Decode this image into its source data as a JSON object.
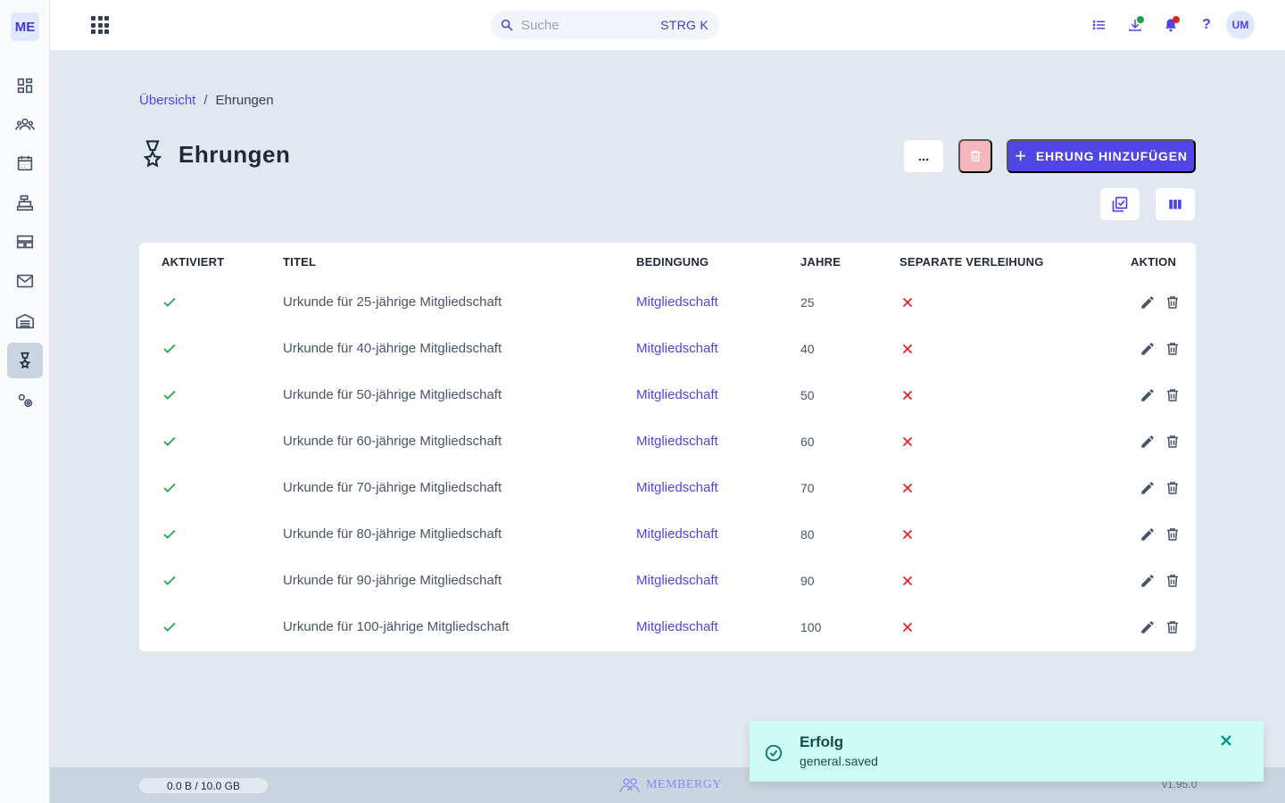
{
  "sidebar": {
    "logo": "ME",
    "items": [
      {
        "icon": "dashboard-icon"
      },
      {
        "icon": "members-icon"
      },
      {
        "icon": "calendar-icon"
      },
      {
        "icon": "cash-register-icon"
      },
      {
        "icon": "layout-icon"
      },
      {
        "icon": "mail-icon"
      },
      {
        "icon": "warehouse-icon"
      },
      {
        "icon": "medal-icon",
        "active": true
      },
      {
        "icon": "settings-icon"
      }
    ]
  },
  "topbar": {
    "search": {
      "placeholder": "Suche",
      "shortcut": "STRG K"
    },
    "avatar": "UM",
    "icons": [
      "task-list-icon",
      "download-icon",
      "bell-icon",
      "help-icon"
    ]
  },
  "breadcrumb": {
    "parent": "Übersicht",
    "separator": "/",
    "current": "Ehrungen"
  },
  "page": {
    "title": "Ehrungen",
    "more_label": "...",
    "add_label": "EHRUNG HINZUFÜGEN"
  },
  "table": {
    "headers": {
      "activated": "AKTIVIERT",
      "title": "TITEL",
      "condition": "BEDINGUNG",
      "years": "JAHRE",
      "separate": "SEPARATE VERLEIHUNG",
      "action": "AKTION"
    },
    "rows": [
      {
        "activated": true,
        "title": "Urkunde für 25-jährige Mitgliedschaft",
        "condition": "Mitgliedschaft",
        "years": "25",
        "separate": false
      },
      {
        "activated": true,
        "title": "Urkunde für 40-jährige Mitgliedschaft",
        "condition": "Mitgliedschaft",
        "years": "40",
        "separate": false
      },
      {
        "activated": true,
        "title": "Urkunde für 50-jährige Mitgliedschaft",
        "condition": "Mitgliedschaft",
        "years": "50",
        "separate": false
      },
      {
        "activated": true,
        "title": "Urkunde für 60-jährige Mitgliedschaft",
        "condition": "Mitgliedschaft",
        "years": "60",
        "separate": false
      },
      {
        "activated": true,
        "title": "Urkunde für 70-jährige Mitgliedschaft",
        "condition": "Mitgliedschaft",
        "years": "70",
        "separate": false
      },
      {
        "activated": true,
        "title": "Urkunde für 80-jährige Mitgliedschaft",
        "condition": "Mitgliedschaft",
        "years": "80",
        "separate": false
      },
      {
        "activated": true,
        "title": "Urkunde für 90-jährige Mitgliedschaft",
        "condition": "Mitgliedschaft",
        "years": "90",
        "separate": false
      },
      {
        "activated": true,
        "title": "Urkunde für 100-jährige Mitgliedschaft",
        "condition": "Mitgliedschaft",
        "years": "100",
        "separate": false
      }
    ]
  },
  "footer": {
    "storage": "0.0 B / 10.0 GB",
    "brand": "MEMBERGY",
    "version": "v1.95.0"
  },
  "toast": {
    "title": "Erfolg",
    "message": "general.saved"
  },
  "colors": {
    "accent": "#4f46e5",
    "success": "#16a34a",
    "danger": "#dc2626",
    "toast_bg": "#ccfbf1"
  }
}
